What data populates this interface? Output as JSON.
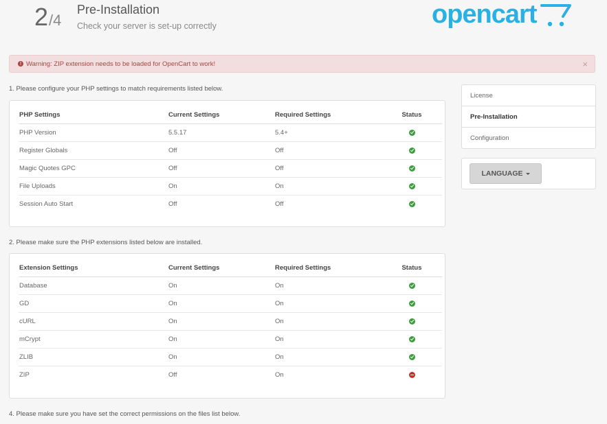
{
  "header": {
    "step_current": "2",
    "step_total": "/4",
    "title": "Pre-Installation",
    "subtitle": "Check your server is set-up correctly",
    "logo_text": "opencart",
    "logo_icon": "cart-icon",
    "brand_color": "#2ab1e4"
  },
  "alert": {
    "text": "Warning: ZIP extension needs to be loaded for OpenCart to work!",
    "icon": "exclamation-circle-icon",
    "close": "×"
  },
  "section1": {
    "instruction": "1. Please configure your PHP settings to match requirements listed below.",
    "headers": [
      "PHP Settings",
      "Current Settings",
      "Required Settings",
      "Status"
    ],
    "rows": [
      {
        "name": "PHP Version",
        "current": "5.5.17",
        "required": "5.4+",
        "status": "ok"
      },
      {
        "name": "Register Globals",
        "current": "Off",
        "required": "Off",
        "status": "ok"
      },
      {
        "name": "Magic Quotes GPC",
        "current": "Off",
        "required": "Off",
        "status": "ok"
      },
      {
        "name": "File Uploads",
        "current": "On",
        "required": "On",
        "status": "ok"
      },
      {
        "name": "Session Auto Start",
        "current": "Off",
        "required": "Off",
        "status": "ok"
      }
    ]
  },
  "section2": {
    "instruction": "2. Please make sure the PHP extensions listed below are installed.",
    "headers": [
      "Extension Settings",
      "Current Settings",
      "Required Settings",
      "Status"
    ],
    "rows": [
      {
        "name": "Database",
        "current": "On",
        "required": "On",
        "status": "ok"
      },
      {
        "name": "GD",
        "current": "On",
        "required": "On",
        "status": "ok"
      },
      {
        "name": "cURL",
        "current": "On",
        "required": "On",
        "status": "ok"
      },
      {
        "name": "mCrypt",
        "current": "On",
        "required": "On",
        "status": "ok"
      },
      {
        "name": "ZLIB",
        "current": "On",
        "required": "On",
        "status": "ok"
      },
      {
        "name": "ZIP",
        "current": "Off",
        "required": "On",
        "status": "error"
      }
    ]
  },
  "section4": {
    "instruction": "4. Please make sure you have set the correct permissions on the files list below."
  },
  "sidebar": {
    "items": [
      {
        "label": "License",
        "active": false
      },
      {
        "label": "Pre-Installation",
        "active": true
      },
      {
        "label": "Configuration",
        "active": false
      }
    ],
    "language_button": "LANGUAGE"
  }
}
